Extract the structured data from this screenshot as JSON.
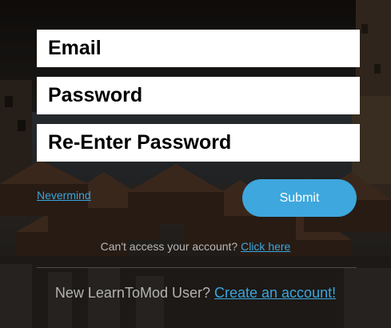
{
  "form": {
    "email_placeholder": "Email",
    "password_placeholder": "Password",
    "reenter_placeholder": "Re-Enter Password"
  },
  "actions": {
    "nevermind_label": "Nevermind",
    "submit_label": "Submit"
  },
  "help": {
    "access_text": "Can't access your account?",
    "access_link": "Click here",
    "new_user_text": "New LearnToMod User?",
    "create_link": "Create an account!"
  },
  "colors": {
    "accent": "#3ea7dd",
    "link": "#3aa6dd",
    "muted_text": "#b3b3b3"
  }
}
